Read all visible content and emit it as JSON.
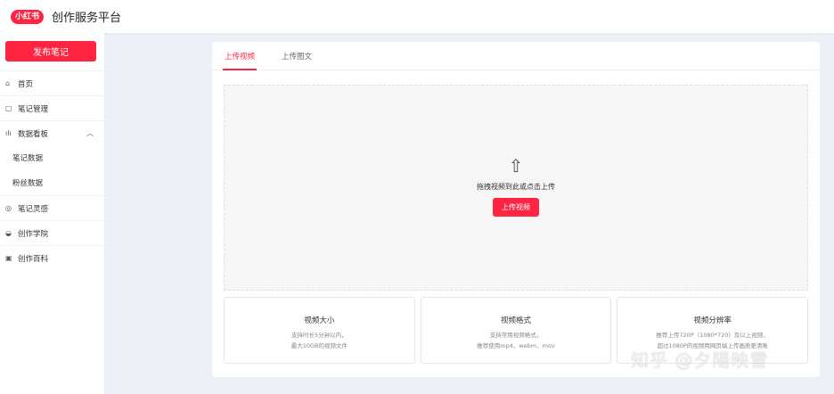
{
  "header": {
    "logo": "小红书",
    "title": "创作服务平台"
  },
  "sidebar": {
    "publish_label": "发布笔记",
    "items": [
      {
        "label": "首页",
        "icon": "home-icon"
      },
      {
        "label": "笔记管理",
        "icon": "note-icon"
      },
      {
        "label": "数据看板",
        "icon": "chart-icon",
        "expanded": true
      },
      {
        "label": "笔记数据"
      },
      {
        "label": "粉丝数据"
      },
      {
        "label": "笔记灵感",
        "icon": "inspiration-icon"
      },
      {
        "label": "创作学院",
        "icon": "academy-icon"
      },
      {
        "label": "创作百科",
        "icon": "wiki-icon"
      }
    ]
  },
  "main": {
    "tabs": [
      {
        "label": "上传视频",
        "active": true
      },
      {
        "label": "上传图文",
        "active": false
      }
    ],
    "drop_text": "拖拽视频到此或点击上传",
    "upload_button": "上传视频",
    "info": [
      {
        "title": "视频大小",
        "lines": [
          "支持时长5分钟以内，",
          "最大10GB的视频文件"
        ]
      },
      {
        "title": "视频格式",
        "lines": [
          "支持常用视频格式，",
          "推荐使用mp4、webm、mov"
        ]
      },
      {
        "title": "视频分辨率",
        "lines": [
          "推荐上传720P（1080*720）及以上视频，",
          "超过1080P的视频用网页端上传画质更清晰"
        ]
      }
    ]
  },
  "watermark": "知乎 @夕陽映雪",
  "colors": {
    "accent": "#ff2442",
    "background": "#eef0f7"
  }
}
